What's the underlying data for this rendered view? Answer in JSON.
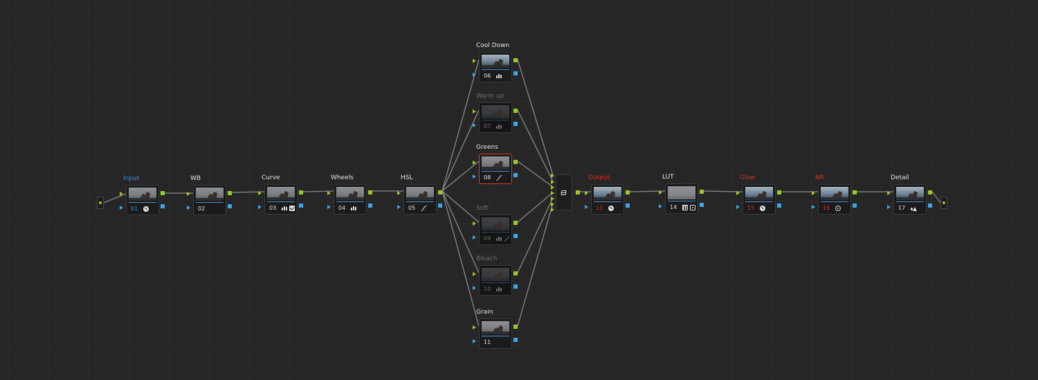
{
  "app": {
    "panel": "Node Editor"
  },
  "colors": {
    "wire": "#8a8a8a",
    "rgb_pin": "#9acb22",
    "alpha_pin": "#3aa7e8",
    "blue_label": "#3b8fe0",
    "red_label": "#d8321f",
    "selected_border": "#d8402a"
  },
  "nodes": {
    "n01": {
      "title": "Input",
      "number": "01",
      "icons": [
        "disc-icon"
      ]
    },
    "n02": {
      "title": "WB",
      "number": "02",
      "icons": []
    },
    "n03": {
      "title": "Curve",
      "number": "03",
      "icons": [
        "bars-icon",
        "check-icon"
      ]
    },
    "n04": {
      "title": "Wheels",
      "number": "04",
      "icons": [
        "bars-icon"
      ]
    },
    "n05": {
      "title": "HSL",
      "number": "05",
      "icons": [
        "curve-icon"
      ]
    },
    "n06": {
      "title": "Cool Down",
      "number": "06",
      "icons": [
        "bars-icon"
      ]
    },
    "n07": {
      "title": "Warm up",
      "number": "07",
      "icons": [
        "bars-icon"
      ],
      "disabled": true
    },
    "n08": {
      "title": "Greens",
      "number": "08",
      "icons": [
        "curve-icon"
      ],
      "selected": true
    },
    "n09": {
      "title": "Soft",
      "number": "09",
      "icons": [
        "bars-icon",
        "wand-icon"
      ],
      "disabled": true
    },
    "n10": {
      "title": "Bleach",
      "number": "10",
      "icons": [
        "bars-icon"
      ],
      "disabled": true
    },
    "n11": {
      "title": "Grain",
      "number": "11",
      "icons": []
    },
    "n13": {
      "title": "Output",
      "number": "13",
      "icons": [
        "disc-icon"
      ]
    },
    "n14": {
      "title": "LUT",
      "number": "14",
      "icons": [
        "grid-icon",
        "camera-icon"
      ]
    },
    "n15": {
      "title": "Glow",
      "number": "15",
      "icons": [
        "disc-icon"
      ]
    },
    "n16": {
      "title": "NR",
      "number": "16",
      "icons": [
        "nr-icon"
      ]
    },
    "n17": {
      "title": "Detail",
      "number": "17",
      "icons": [
        "drops-icon"
      ]
    }
  },
  "mixer": {
    "icon": "layers-icon",
    "inputs": 7
  }
}
